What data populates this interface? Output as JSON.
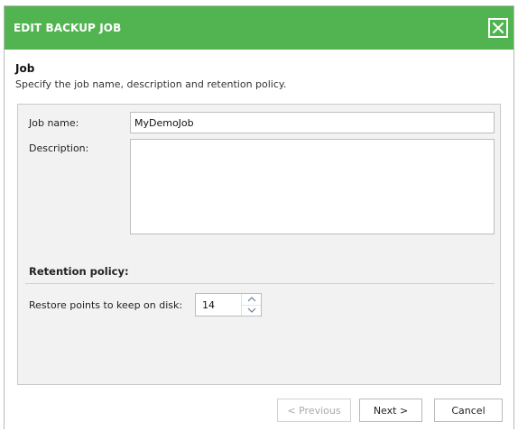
{
  "dialog": {
    "title": "EDIT BACKUP JOB",
    "close_icon": "close-icon"
  },
  "section": {
    "title": "Job",
    "description": "Specify the job name, description and retention policy."
  },
  "form": {
    "job_name_label": "Job name:",
    "job_name_value": "MyDemoJob",
    "description_label": "Description:",
    "description_value": "",
    "retention_heading": "Retention policy:",
    "restore_points_label": "Restore points to keep on disk:",
    "restore_points_value": "14"
  },
  "buttons": {
    "previous": "< Previous",
    "next": "Next >",
    "cancel": "Cancel"
  },
  "colors": {
    "title_bar": "#52b451",
    "panel_bg": "#f2f2f2"
  }
}
